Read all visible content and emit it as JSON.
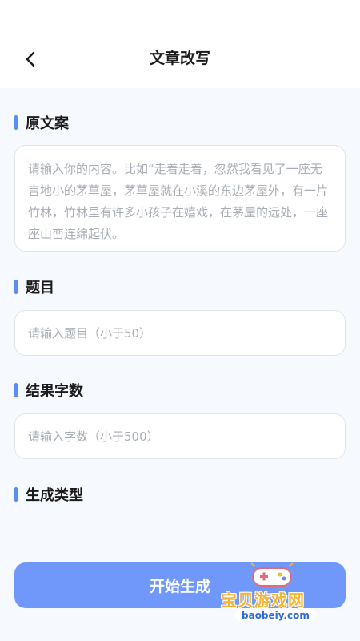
{
  "header": {
    "title": "文章改写",
    "back_icon": "chevron-left-icon"
  },
  "sections": {
    "original": {
      "label": "原文案",
      "placeholder": "请输入你的内容。比如“走着走着，忽然我看见了一座无言地小的茅草屋，茅草屋就在小溪的东边茅屋外，有一片竹林，竹林里有许多小孩子在嬉戏，在茅屋的远处，一座座山峦连绵起伏。"
    },
    "topic": {
      "label": "题目",
      "placeholder": "请输入题目（小于50）"
    },
    "word_count": {
      "label": "结果字数",
      "placeholder": "请输入字数（小于500）"
    },
    "gen_type": {
      "label": "生成类型"
    }
  },
  "actions": {
    "start_label": "开始生成"
  },
  "watermark": {
    "text": "宝贝游戏网",
    "url": "baobeiy.com"
  },
  "colors": {
    "accent": "#5b8cf5",
    "button": "#6f98fa",
    "background": "#f6f9fe"
  }
}
